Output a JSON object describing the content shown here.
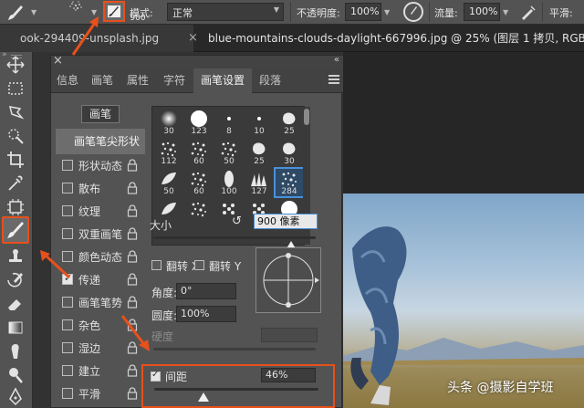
{
  "options_bar": {
    "brush_size": "900",
    "mode_label": "模式:",
    "mode_value": "正常",
    "opacity_label": "不透明度:",
    "opacity_value": "100%",
    "flow_label": "流量:",
    "flow_value": "100%",
    "smoothing_label": "平滑:"
  },
  "tabs": {
    "tab1": "ook-294409-unsplash.jpg",
    "tab1_close": "×",
    "tab2": "blue-mountains-clouds-daylight-667996.jpg @ 25% (图层 1 拷贝, RGB"
  },
  "toolbar": {
    "icons": [
      "move-icon",
      "marquee-icon",
      "lasso-icon",
      "quick-select-icon",
      "crop-icon",
      "eyedropper-icon",
      "frame-icon",
      "brush-icon",
      "stamp-icon",
      "history-brush-icon",
      "eraser-icon",
      "gradient-icon",
      "smudge-icon",
      "dodge-icon",
      "pen-icon"
    ]
  },
  "panel": {
    "close": "×",
    "collapse": "«",
    "tabs": [
      {
        "label": "信息"
      },
      {
        "label": "画笔"
      },
      {
        "label": "属性"
      },
      {
        "label": "字符"
      },
      {
        "label": "画笔设置",
        "active": true
      },
      {
        "label": "段落"
      }
    ],
    "brush_button": "画笔",
    "tip_shape": "画笔笔尖形状",
    "options": [
      {
        "label": "形状动态",
        "checked": false
      },
      {
        "label": "散布",
        "checked": false
      },
      {
        "label": "纹理",
        "checked": false
      },
      {
        "label": "双重画笔",
        "checked": false
      },
      {
        "label": "颜色动态",
        "checked": false
      },
      {
        "label": "传递",
        "checked": true
      },
      {
        "label": "画笔笔势",
        "checked": false
      },
      {
        "label": "杂色",
        "checked": false
      },
      {
        "label": "湿边",
        "checked": false
      },
      {
        "label": "建立",
        "checked": false
      },
      {
        "label": "平滑",
        "checked": false
      }
    ],
    "presets": [
      {
        "num": "30",
        "kind": "soft"
      },
      {
        "num": "123",
        "kind": "hard"
      },
      {
        "num": "8",
        "kind": "dot"
      },
      {
        "num": "10",
        "kind": "dot"
      },
      {
        "num": "25",
        "kind": "blob"
      },
      {
        "num": "112",
        "kind": "scatter"
      },
      {
        "num": "60",
        "kind": "scatter"
      },
      {
        "num": "50",
        "kind": "scatter"
      },
      {
        "num": "25",
        "kind": "blob"
      },
      {
        "num": "30",
        "kind": "blob"
      },
      {
        "num": "50",
        "kind": "leaf"
      },
      {
        "num": "60",
        "kind": "scatter"
      },
      {
        "num": "100",
        "kind": "oval"
      },
      {
        "num": "127",
        "kind": "grass"
      },
      {
        "num": "284",
        "kind": "scatter",
        "selected": true
      },
      {
        "num": "",
        "kind": "leaf"
      },
      {
        "num": "",
        "kind": "scatter"
      },
      {
        "num": "",
        "kind": "dots"
      },
      {
        "num": "",
        "kind": "dots"
      },
      {
        "num": "",
        "kind": "hard"
      }
    ],
    "size_label": "大小",
    "size_reset": "↺",
    "size_value": "900 像素",
    "size_slider": 0.85,
    "flip_x": "翻转 X",
    "flip_y": "翻转 Y",
    "angle_label": "角度:",
    "angle_value": "0°",
    "roundness_label": "圆度:",
    "roundness_value": "100%",
    "hardness_label": "硬度",
    "spacing_label": "间距",
    "spacing_value": "46%",
    "spacing_slider": 0.3
  },
  "colors": {
    "accent": "#e8501c",
    "selection": "#4a90d9"
  },
  "watermark": "头条 @摄影自学班"
}
